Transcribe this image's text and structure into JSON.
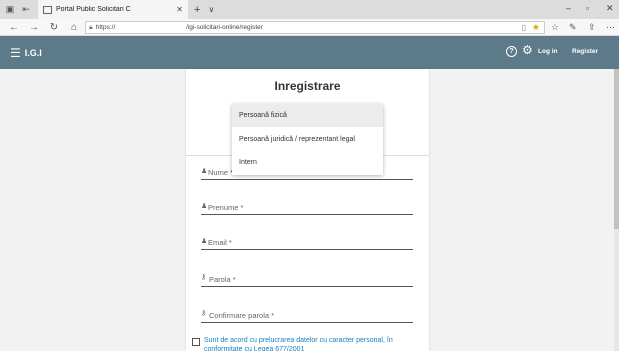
{
  "browser": {
    "tab_title": "Portal Public Solicitari C",
    "url_prefix": "https://",
    "url_path": "/igi-solicitari-online/register"
  },
  "header": {
    "brand": "I.G.I",
    "login_label": "Log in",
    "register_label": "Register",
    "color": "#5c7a89"
  },
  "form": {
    "title": "Inregistrare",
    "fields": {
      "nume": "Nume *",
      "prenume": "Prenume *",
      "email": "Email *",
      "parola": "Parola *",
      "confirmare": "Confirmare parola *"
    },
    "terms_text": "Sunt de acord cu prelucrarea datelor cu caracter personal, în conformitate cu Legea 677/2001"
  },
  "dropdown": {
    "options": [
      "Persoană fizică",
      "Persoană juridică / reprezentant legal",
      "Intern"
    ],
    "highlighted": "Persoană fizică"
  },
  "accent_link": "#1a7fc0"
}
